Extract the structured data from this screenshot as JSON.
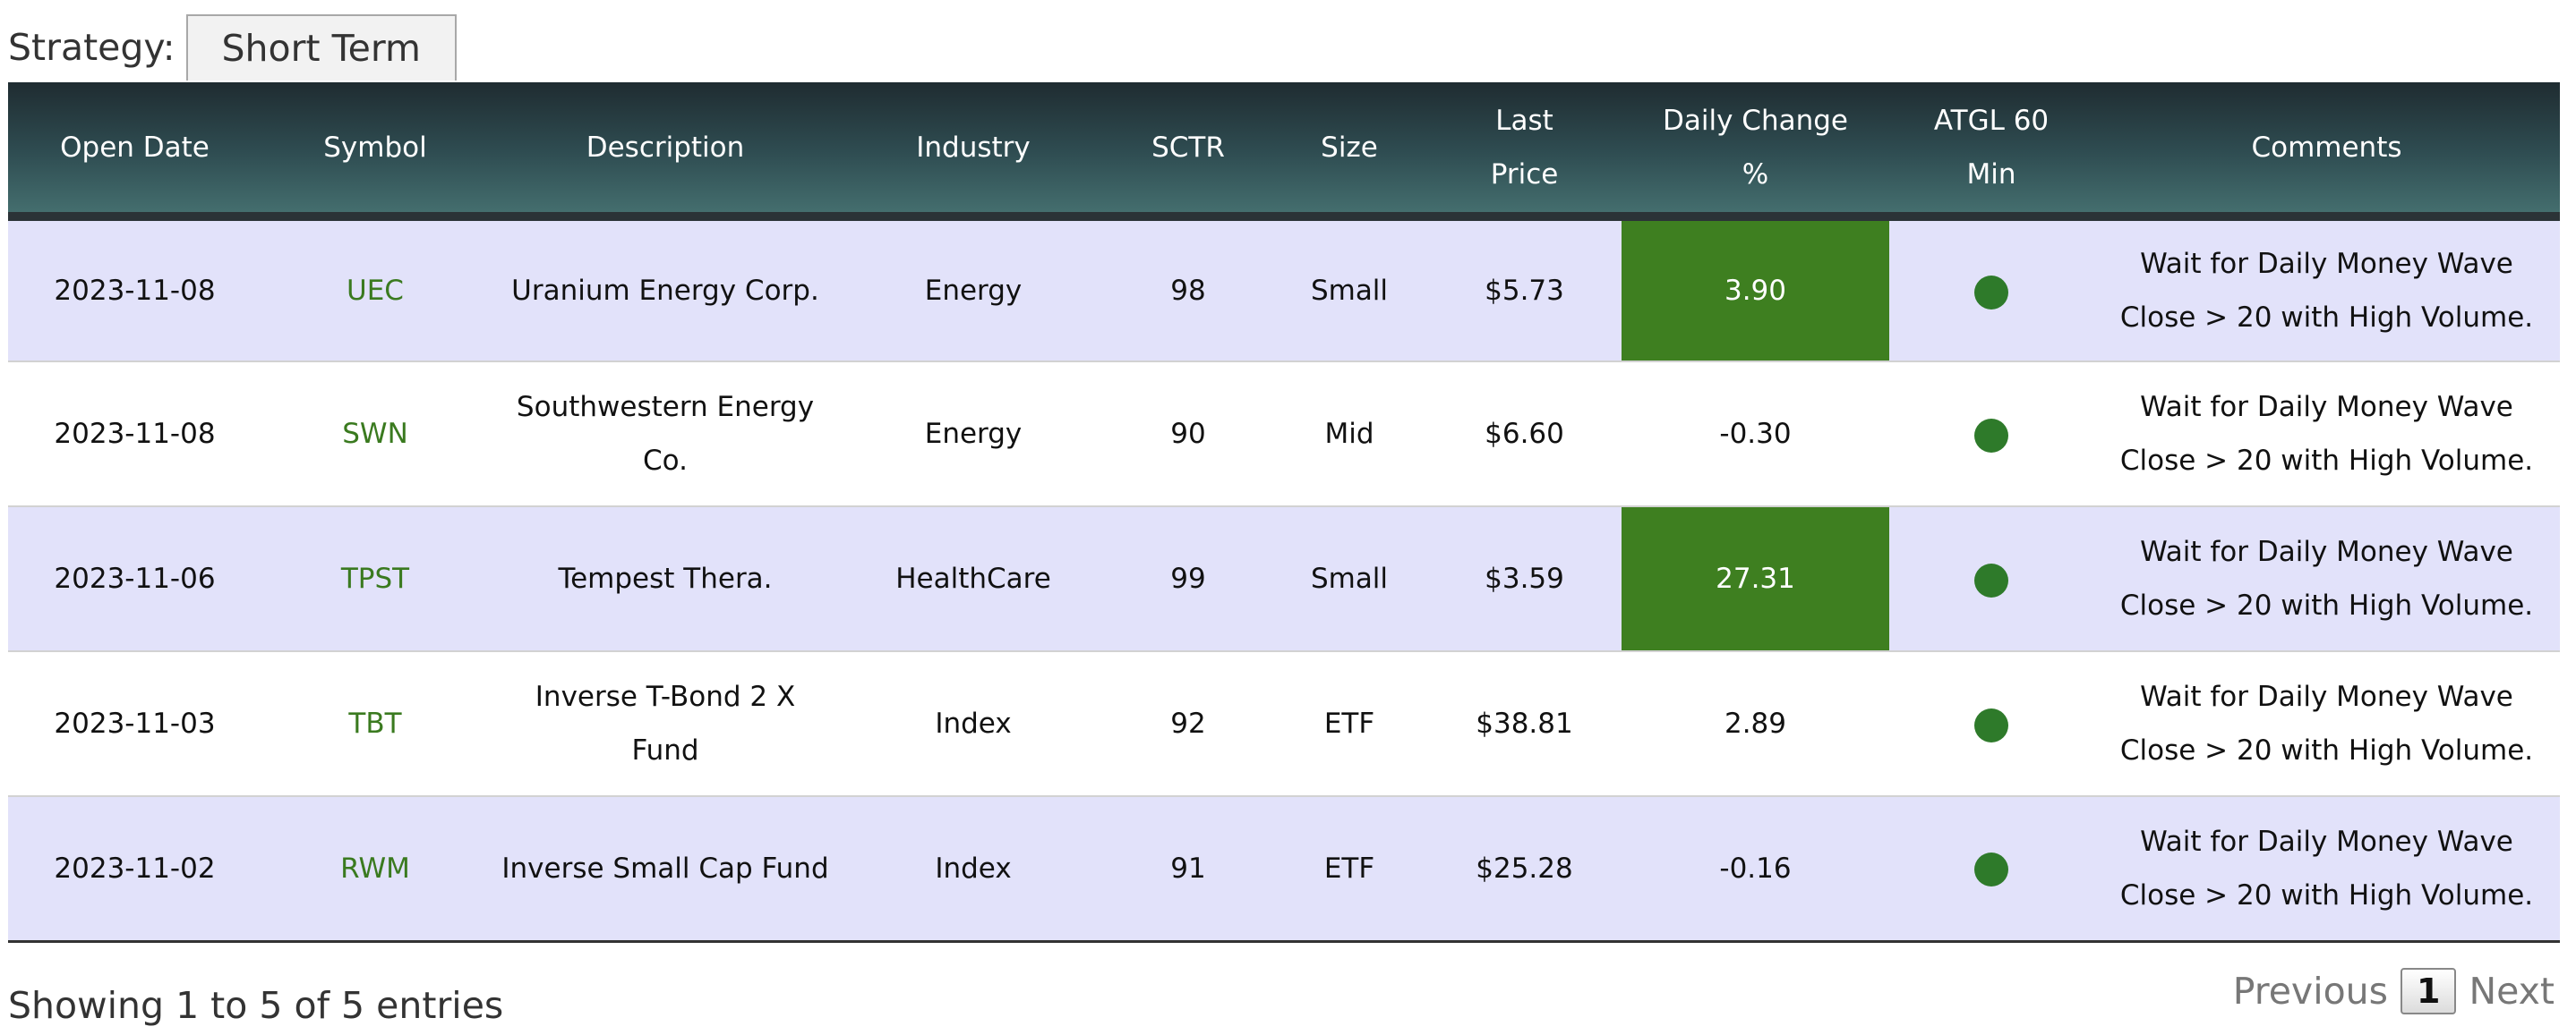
{
  "strategy": {
    "label": "Strategy:",
    "value": "Short Term"
  },
  "table": {
    "headers": [
      {
        "line1": "Open Date",
        "line2": ""
      },
      {
        "line1": "Symbol",
        "line2": ""
      },
      {
        "line1": "Description",
        "line2": ""
      },
      {
        "line1": "Industry",
        "line2": ""
      },
      {
        "line1": "SCTR",
        "line2": ""
      },
      {
        "line1": "Size",
        "line2": ""
      },
      {
        "line1": "Last",
        "line2": "Price"
      },
      {
        "line1": "Daily Change",
        "line2": "%"
      },
      {
        "line1": "ATGL 60",
        "line2": "Min"
      },
      {
        "line1": "Comments",
        "line2": ""
      }
    ],
    "rows": [
      {
        "open_date": "2023-11-08",
        "symbol": "UEC",
        "description": "Uranium Energy Corp.",
        "industry": "Energy",
        "sctr": "98",
        "size": "Small",
        "last_price": "$5.73",
        "daily_change": "3.90",
        "comment_line1": "Wait for Daily Money Wave",
        "comment_line2": "Close > 20 with High Volume."
      },
      {
        "open_date": "2023-11-08",
        "symbol": "SWN",
        "description": "Southwestern Energy Co.",
        "industry": "Energy",
        "sctr": "90",
        "size": "Mid",
        "last_price": "$6.60",
        "daily_change": "-0.30",
        "comment_line1": "Wait for Daily Money Wave",
        "comment_line2": "Close > 20 with High Volume."
      },
      {
        "open_date": "2023-11-06",
        "symbol": "TPST",
        "description": "Tempest Thera.",
        "industry": "HealthCare",
        "sctr": "99",
        "size": "Small",
        "last_price": "$3.59",
        "daily_change": "27.31",
        "comment_line1": "Wait for Daily Money Wave",
        "comment_line2": "Close > 20 with High Volume."
      },
      {
        "open_date": "2023-11-03",
        "symbol": "TBT",
        "description": "Inverse T-Bond 2 X Fund",
        "industry": "Index",
        "sctr": "92",
        "size": "ETF",
        "last_price": "$38.81",
        "daily_change": "2.89",
        "comment_line1": "Wait for Daily Money Wave",
        "comment_line2": "Close > 20 with High Volume."
      },
      {
        "open_date": "2023-11-02",
        "symbol": "RWM",
        "description": "Inverse Small Cap Fund",
        "industry": "Index",
        "sctr": "91",
        "size": "ETF",
        "last_price": "$25.28",
        "daily_change": "-0.16",
        "comment_line1": "Wait for Daily Money Wave",
        "comment_line2": "Close > 20 with High Volume."
      }
    ]
  },
  "footer": {
    "info": "Showing 1 to 5 of 5 entries",
    "previous": "Previous",
    "page": "1",
    "next": "Next"
  },
  "colors": {
    "positive_change_bg": "#3e7f20",
    "symbol_link": "#3a7a1f",
    "status_dot": "#2e7a2a",
    "odd_row_bg": "#e2e2fa"
  },
  "icons": {
    "atgl_status": "status-dot-icon"
  }
}
